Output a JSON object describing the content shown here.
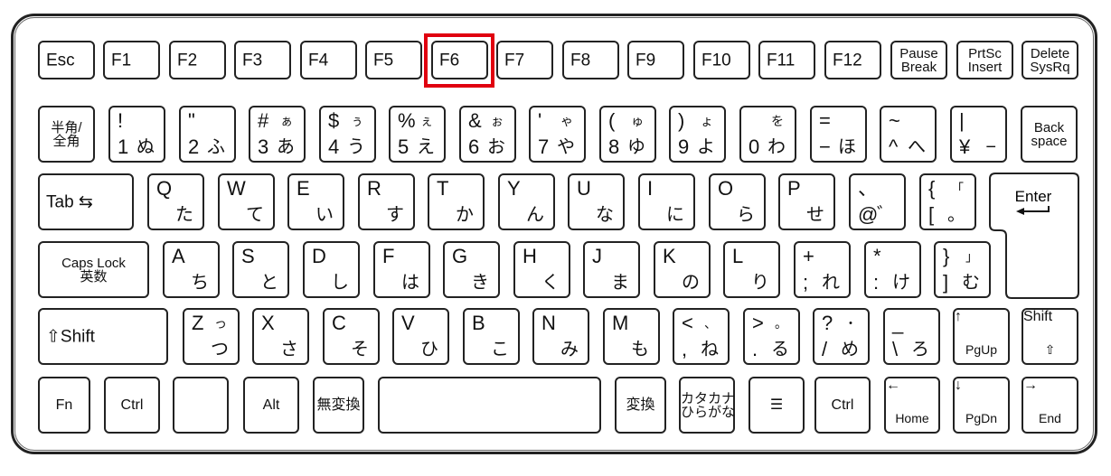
{
  "highlight_color": "#e0000f",
  "highlighted_key": "F6",
  "rows": [
    [
      {
        "label": "Esc"
      },
      {
        "label": "F1"
      },
      {
        "label": "F2"
      },
      {
        "label": "F3"
      },
      {
        "label": "F4"
      },
      {
        "label": "F5"
      },
      {
        "label": "F6"
      },
      {
        "label": "F7"
      },
      {
        "label": "F8"
      },
      {
        "label": "F9"
      },
      {
        "label": "F10"
      },
      {
        "label": "F11"
      },
      {
        "label": "F12"
      },
      {
        "lines": "Pause\nBreak"
      },
      {
        "lines": "PrtSc\nInsert"
      },
      {
        "lines": "Delete\nSysRq"
      }
    ],
    [
      {
        "lines": "半角/\n全角"
      },
      {
        "tl": "!",
        "bl": "1",
        "br": "ぬ"
      },
      {
        "tl": "\"",
        "bl": "2",
        "br": "ふ"
      },
      {
        "tl": "#",
        "tr": "ぁ",
        "bl": "3",
        "br": "あ"
      },
      {
        "tl": "$",
        "tr": "ぅ",
        "bl": "4",
        "br": "う"
      },
      {
        "tl": "%",
        "tr": "ぇ",
        "bl": "5",
        "br": "え"
      },
      {
        "tl": "&",
        "tr": "ぉ",
        "bl": "6",
        "br": "お"
      },
      {
        "tl": "'",
        "tr": "ゃ",
        "bl": "7",
        "br": "や"
      },
      {
        "tl": "(",
        "tr": "ゅ",
        "bl": "8",
        "br": "ゆ"
      },
      {
        "tl": ")",
        "tr": "ょ",
        "bl": "9",
        "br": "よ"
      },
      {
        "tr": "を",
        "bl": "0",
        "br": "わ"
      },
      {
        "tl": "=",
        "bl": "−",
        "br": "ほ"
      },
      {
        "tl": "~",
        "bl": "^",
        "br": "へ"
      },
      {
        "tl": "|",
        "bl": "¥",
        "br": "−"
      },
      {
        "lines": "Back\nspace"
      }
    ],
    [
      {
        "label": "Tab ⇆"
      },
      {
        "tl": "Q",
        "br": "た"
      },
      {
        "tl": "W",
        "br": "て"
      },
      {
        "tl": "E",
        "br": "い"
      },
      {
        "tl": "R",
        "br": "す"
      },
      {
        "tl": "T",
        "br": "か"
      },
      {
        "tl": "Y",
        "br": "ん"
      },
      {
        "tl": "U",
        "br": "な"
      },
      {
        "tl": "I",
        "br": "に"
      },
      {
        "tl": "O",
        "br": "ら"
      },
      {
        "tl": "P",
        "br": "せ"
      },
      {
        "tl": "、",
        "bl": "@",
        "br": "゛"
      },
      {
        "tl": "{",
        "tr": "「",
        "bl": "[",
        "br": "。"
      }
    ],
    [
      {
        "lines": "Caps Lock\n英数"
      },
      {
        "tl": "A",
        "br": "ち"
      },
      {
        "tl": "S",
        "br": "と"
      },
      {
        "tl": "D",
        "br": "し"
      },
      {
        "tl": "F",
        "br": "は"
      },
      {
        "tl": "G",
        "br": "き"
      },
      {
        "tl": "H",
        "br": "く"
      },
      {
        "tl": "J",
        "br": "ま"
      },
      {
        "tl": "K",
        "br": "の"
      },
      {
        "tl": "L",
        "br": "り"
      },
      {
        "tl": "+",
        "bl": ";",
        "br": "れ"
      },
      {
        "tl": "*",
        "bl": ":",
        "br": "け"
      },
      {
        "tl": "}",
        "tr": "」",
        "bl": "]",
        "br": "む"
      }
    ],
    [
      {
        "label": "⇧Shift"
      },
      {
        "tl": "Z",
        "tr": "っ",
        "br": "つ"
      },
      {
        "tl": "X",
        "br": "さ"
      },
      {
        "tl": "C",
        "br": "そ"
      },
      {
        "tl": "V",
        "br": "ひ"
      },
      {
        "tl": "B",
        "br": "こ"
      },
      {
        "tl": "N",
        "br": "み"
      },
      {
        "tl": "M",
        "br": "も"
      },
      {
        "tl": "<",
        "tr": "、",
        "bl": ",",
        "br": "ね"
      },
      {
        "tl": ">",
        "tr": "。",
        "bl": ".",
        "br": "る"
      },
      {
        "tl": "?",
        "tr": "・",
        "bl": "/",
        "br": "め"
      },
      {
        "tl": "_",
        "bl": "\\",
        "br": "ろ"
      },
      {
        "icon": "↑",
        "sub": "PgUp",
        "icon_name": "arrow-up-icon"
      },
      {
        "icon": "Shift",
        "sub": "⇧",
        "icon_name": "shift-icon"
      }
    ],
    [
      {
        "center": "Fn"
      },
      {
        "center": "Ctrl"
      },
      {
        "center": ""
      },
      {
        "center": "Alt"
      },
      {
        "center": "無変換"
      },
      {
        "center": ""
      },
      {
        "center": "変換"
      },
      {
        "lines": "カタカナ\nひらがな"
      },
      {
        "center": "☰",
        "icon_name": "menu-icon"
      },
      {
        "center": "Ctrl"
      },
      {
        "icon": "←",
        "sub": "Home",
        "icon_name": "arrow-left-icon"
      },
      {
        "icon": "↓",
        "sub": "PgDn",
        "icon_name": "arrow-down-icon"
      },
      {
        "icon": "→",
        "sub": "End",
        "icon_name": "arrow-right-icon"
      }
    ]
  ],
  "enter": {
    "label": "Enter",
    "icon": "↵"
  }
}
